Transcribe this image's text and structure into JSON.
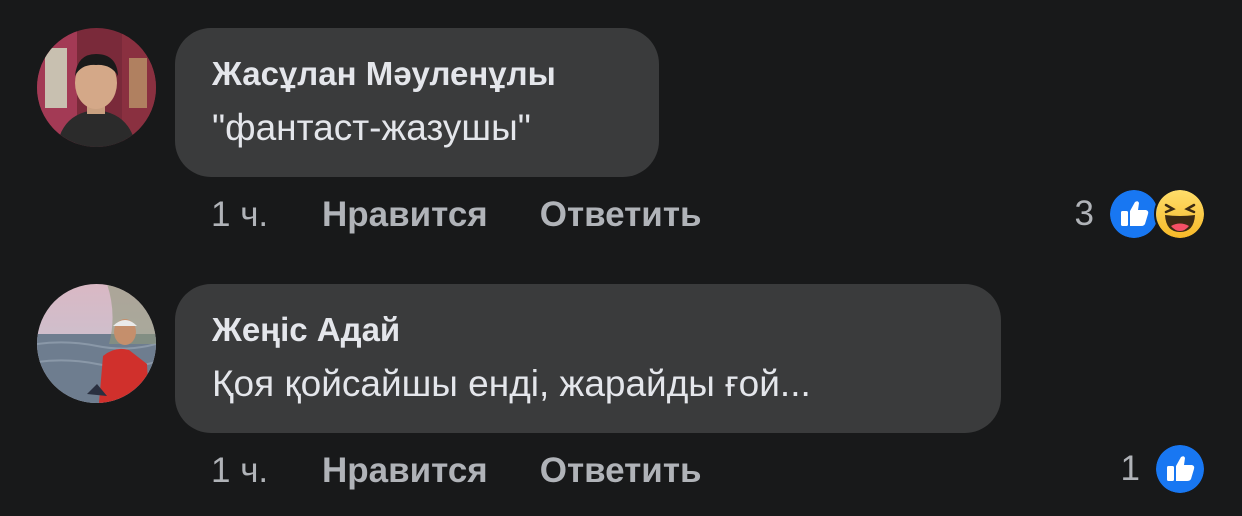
{
  "comments": [
    {
      "author": "Жасұлан Мәуленұлы",
      "text": "\"фантаст-жазушы\"",
      "time": "1 ч.",
      "like_label": "Нравится",
      "reply_label": "Ответить",
      "reaction_count": "3",
      "reactions": [
        "like-icon",
        "haha-icon"
      ]
    },
    {
      "author": "Жеңіс Адай",
      "text": "Қоя қойсайшы енді, жарайды ғой...",
      "time": "1 ч.",
      "like_label": "Нравится",
      "reply_label": "Ответить",
      "reaction_count": "1",
      "reactions": [
        "like-icon"
      ]
    }
  ],
  "colors": {
    "background": "#18191a",
    "bubble": "#3a3b3c",
    "primary_text": "#e4e6eb",
    "secondary_text": "#b0b3b8",
    "like_blue": "#1877f2",
    "haha_yellow": "#f7b928"
  }
}
